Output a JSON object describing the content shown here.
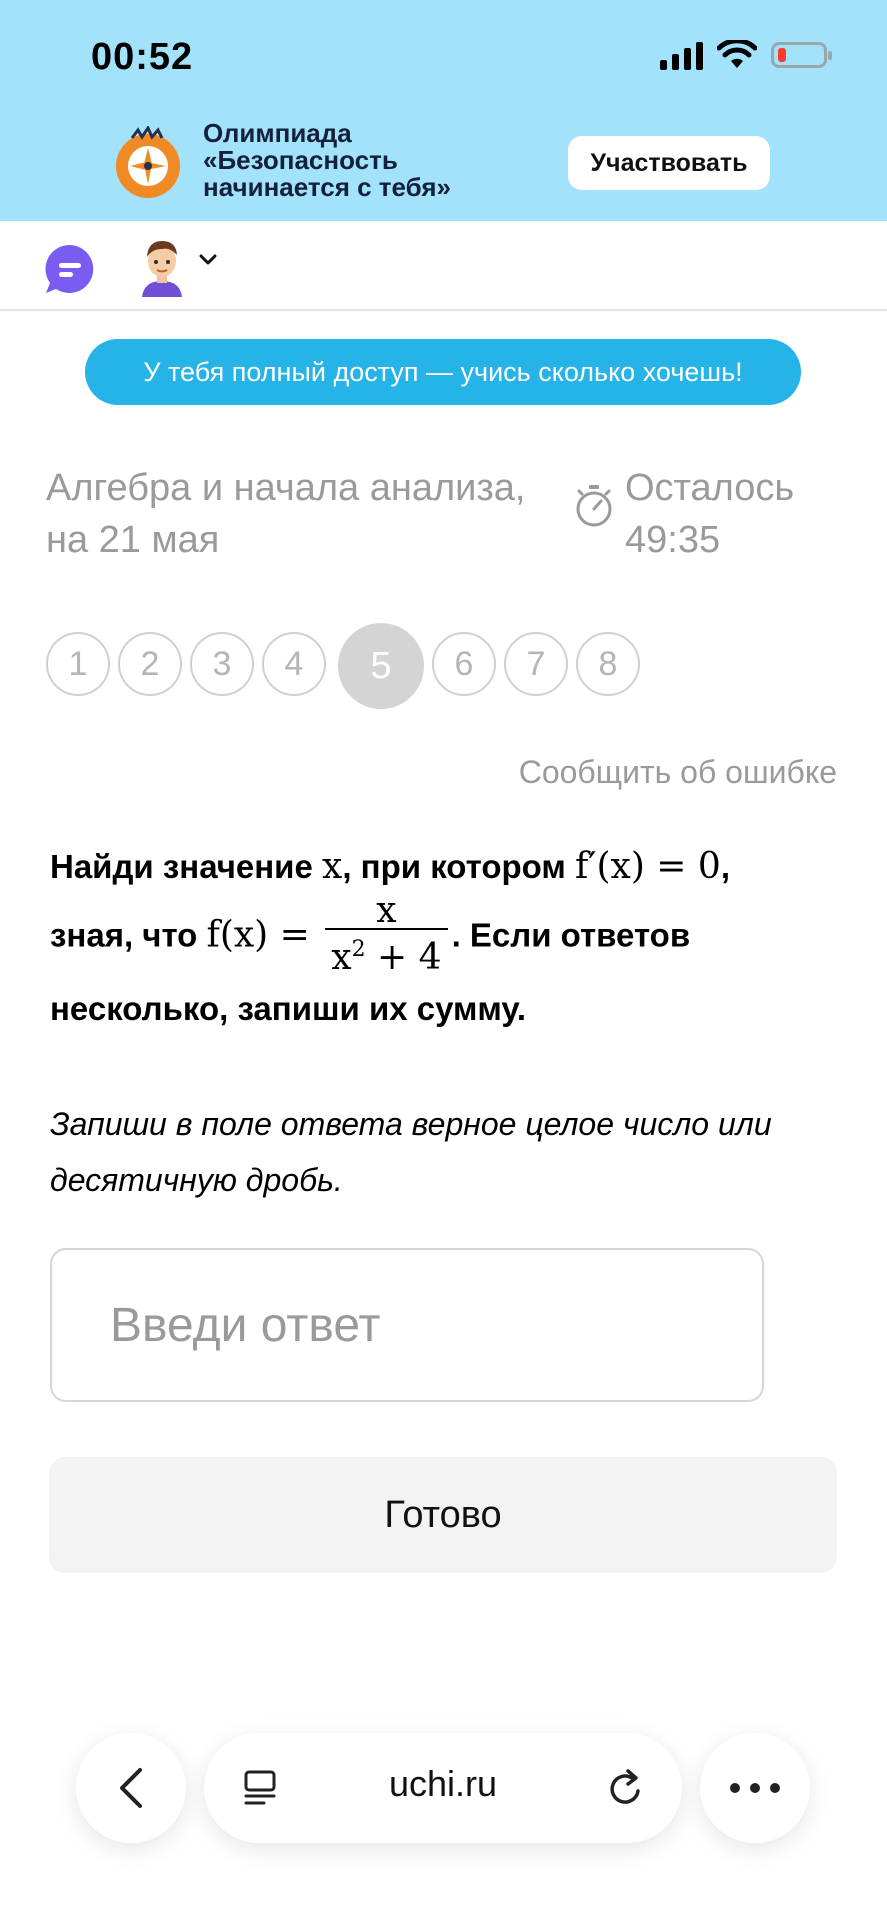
{
  "status_bar": {
    "time": "00:52"
  },
  "banner": {
    "title_lines": [
      "Олимпиада",
      "«Безопасность",
      "начинается с тебя»"
    ],
    "cta_label": "Участвовать",
    "bg_color": "#a3e2fb"
  },
  "header": {
    "chat_icon": "chat-bubble-icon",
    "avatar_icon": "avatar-icon"
  },
  "access_banner": {
    "text": "У тебя полный доступ — учись сколько хочешь!",
    "color": "#26b3e8"
  },
  "lesson": {
    "subject_line1": "Алгебра и начала анализа,",
    "subject_line2": "на 21 мая",
    "timer_label": "Осталось",
    "timer_value": "49:35"
  },
  "question_nav": {
    "items": [
      "1",
      "2",
      "3",
      "4",
      "5",
      "6",
      "7",
      "8"
    ],
    "active": "5"
  },
  "report_error": "Сообщить об ошибке",
  "question": {
    "part1": "Найди значение ",
    "var_x": "x",
    "part2": ", при котором ",
    "deriv_expr": "f′(x) = 0",
    "part3": ",",
    "part4": "зная, что ",
    "f_expr": "f(x) = ",
    "frac_num": "x",
    "frac_den_base": "x",
    "frac_den_exp": "2",
    "frac_den_rest": " + 4",
    "part5": ". Если ответов",
    "part6": "несколько, запиши их сумму."
  },
  "instruction": "Запиши в поле ответа верное целое число или десятичную дробь.",
  "answer": {
    "placeholder": "Введи ответ",
    "value": ""
  },
  "done_button": "Готово",
  "browser": {
    "url": "uchi.ru"
  }
}
